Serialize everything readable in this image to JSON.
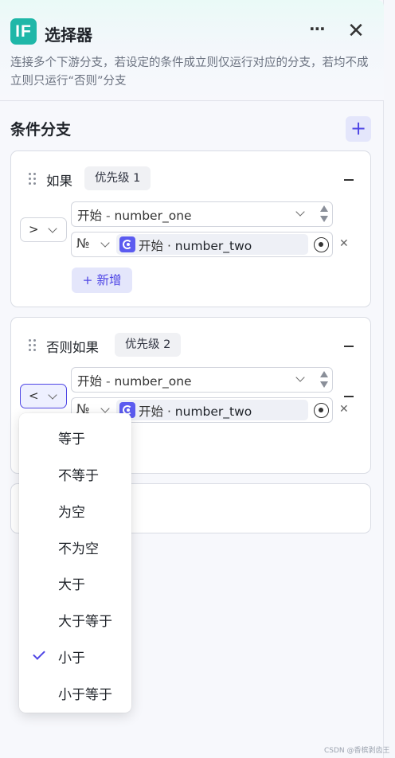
{
  "header": {
    "logo_text": "IF",
    "title": "选择器",
    "more_label": "⋯",
    "close_label": "✕",
    "description": "连接多个下游分支，若设定的条件成立则仅运行对应的分支，若均不成立则只运行“否则”分支"
  },
  "section": {
    "title": "条件分支",
    "add_label": "+"
  },
  "branches": [
    {
      "label": "如果",
      "priority": "优先级 1",
      "operator": ">",
      "left_var": {
        "source": "开始",
        "sep": " - ",
        "name": "number_one"
      },
      "no_symbol": "№",
      "right_ref": {
        "source": "开始",
        "sep": " · ",
        "name": "number_two"
      },
      "add_label": "+ 新增"
    },
    {
      "label": "否则如果",
      "priority": "优先级 2",
      "operator": "<",
      "left_var": {
        "source": "开始",
        "sep": " - ",
        "name": "number_one"
      },
      "no_symbol": "№",
      "right_ref": {
        "source": "开始",
        "sep": " · ",
        "name": "number_two"
      }
    }
  ],
  "dropdown": {
    "options": [
      "等于",
      "不等于",
      "为空",
      "不为空",
      "大于",
      "大于等于",
      "小于",
      "小于等于"
    ],
    "selected": "小于"
  },
  "watermark": "CSDN @香槟剥齿王",
  "colors": {
    "accent": "#4f46e5",
    "logo": "#1fb7a8",
    "ref_icon": "#5b5bf0"
  }
}
